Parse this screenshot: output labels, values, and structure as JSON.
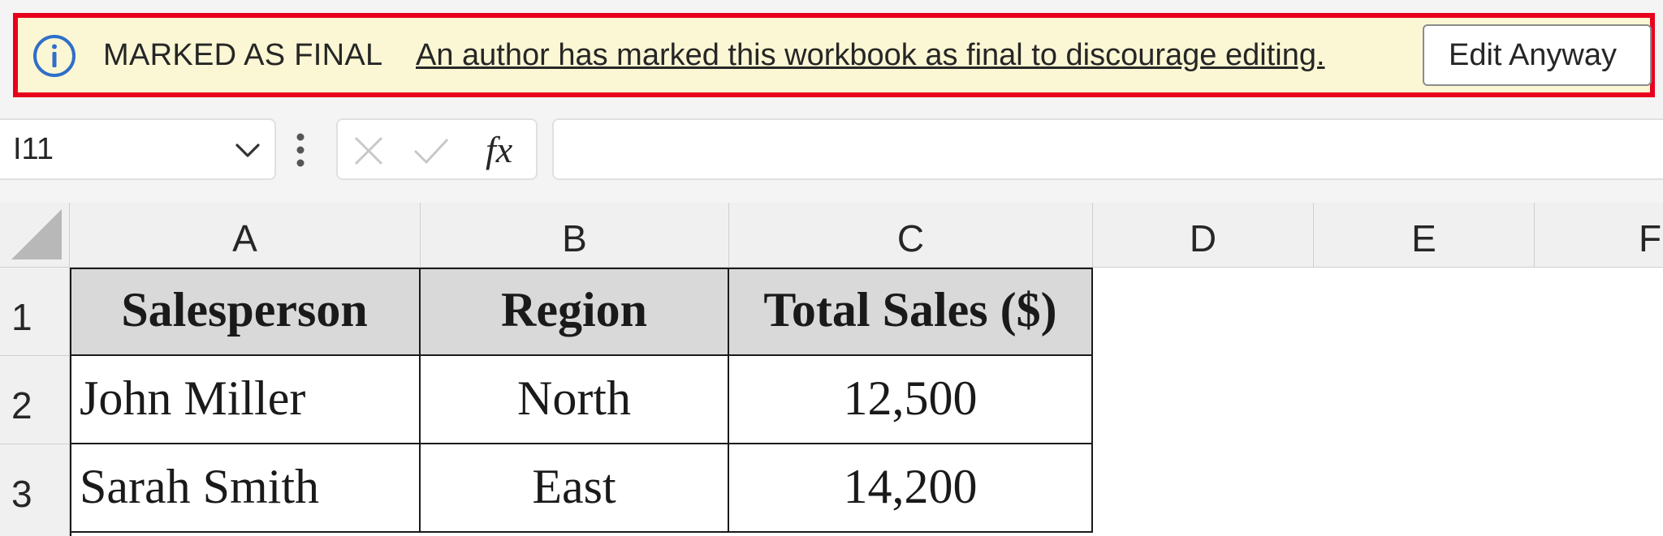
{
  "banner": {
    "title": "MARKED AS FINAL",
    "message": "An author has marked this workbook as final to discourage editing.",
    "edit_button_label": "Edit Anyway"
  },
  "formula_bar": {
    "name_box_value": "I11",
    "fx_label": "fx",
    "formula_value": ""
  },
  "columns": [
    "A",
    "B",
    "C",
    "D",
    "E",
    "F"
  ],
  "rows": [
    "1",
    "2",
    "3"
  ],
  "table": {
    "headers": [
      "Salesperson",
      "Region",
      "Total Sales ($)"
    ],
    "data": [
      [
        "John Miller",
        "North",
        "12,500"
      ],
      [
        "Sarah Smith",
        "East",
        "14,200"
      ]
    ]
  },
  "colors": {
    "banner_bg": "#fbf7d4",
    "highlight_border": "#e8001c",
    "info_icon": "#2f6fc9",
    "header_fill": "#d9d9d9"
  },
  "icons": {
    "info": "info-circle-icon",
    "dropdown": "chevron-down-icon",
    "more": "vertical-ellipsis-icon",
    "cancel": "x-icon",
    "enter": "checkmark-icon",
    "function": "fx-icon"
  }
}
